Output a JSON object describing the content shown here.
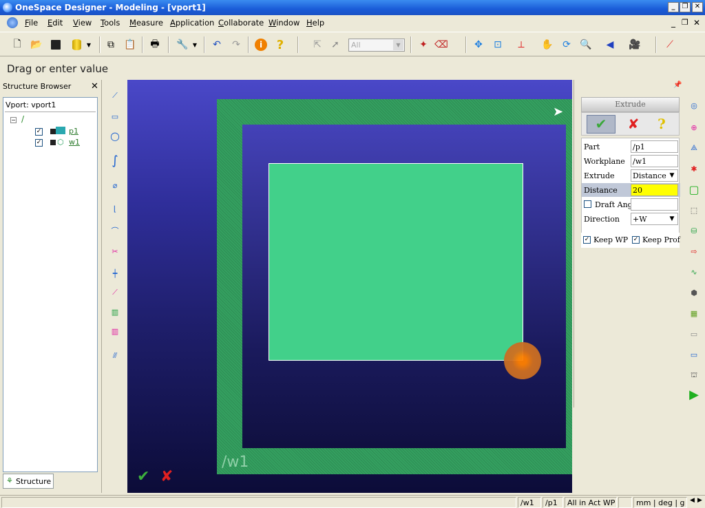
{
  "window": {
    "title": "OneSpace Designer - Modeling - [vport1]"
  },
  "menu": [
    "File",
    "Edit",
    "View",
    "Tools",
    "Measure",
    "Application",
    "Collaborate",
    "Window",
    "Help"
  ],
  "toolbar": {
    "filter_value": "All"
  },
  "prompt": {
    "text": "Drag or enter value"
  },
  "structure": {
    "header": "Structure Browser",
    "root": "Vport: vport1",
    "items": [
      {
        "label": "p1",
        "checked": true
      },
      {
        "label": "w1",
        "checked": true
      }
    ],
    "tab": "Structure"
  },
  "viewport": {
    "workplane_label": "/w1"
  },
  "extrude": {
    "title": "Extrude",
    "part_label": "Part",
    "part_value": "/p1",
    "workplane_label": "Workplane",
    "workplane_value": "/w1",
    "extrude_label": "Extrude",
    "extrude_value": "Distance",
    "distance_label": "Distance",
    "distance_value": "20",
    "draft_label": "Draft Ang",
    "draft_value": "",
    "direction_label": "Direction",
    "direction_value": "+W",
    "keep_wp_label": "Keep WP",
    "keep_prof_label": "Keep Prof"
  },
  "status": {
    "wp": "/w1",
    "part": "/p1",
    "mode": "All in Act WP",
    "units": "mm | deg | g"
  },
  "colors": {
    "title_bar": "#1a5cd8",
    "face": "#42d08a",
    "border": "#34a060",
    "highlight": "#ffff00",
    "handle": "#ff8000"
  }
}
